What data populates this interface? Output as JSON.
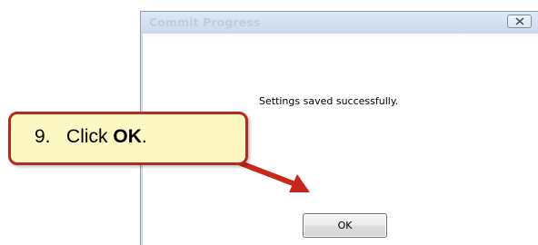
{
  "dialog": {
    "title": "Commit Progress",
    "message": "Settings saved successfully.",
    "ok_label": "OK",
    "close_icon": "close-icon"
  },
  "callout": {
    "step_number": "9.",
    "text_prefix": "Click ",
    "text_bold": "OK",
    "text_suffix": "."
  },
  "colors": {
    "callout_border": "#b52a1e",
    "callout_fill": "#fdf7c3",
    "arrow": "#c8271b"
  }
}
